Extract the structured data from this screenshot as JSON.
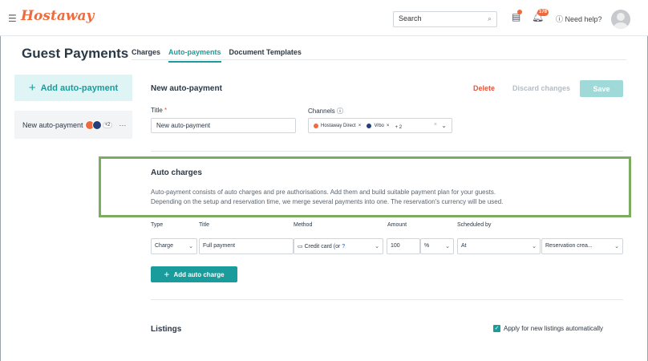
{
  "header": {
    "logo": "Hostaway",
    "search_placeholder": "Search",
    "badge_count": "178",
    "help": "Need help?"
  },
  "page": {
    "title": "Guest Payments",
    "tabs": [
      {
        "label": "Charges",
        "active": false
      },
      {
        "label": "Auto-payments",
        "active": true
      },
      {
        "label": "Document Templates",
        "active": false
      }
    ]
  },
  "sidebar": {
    "add_button": "Add auto-payment",
    "items": [
      {
        "label": "New auto-payment",
        "extra": "+2"
      }
    ]
  },
  "form": {
    "heading": "New auto-payment",
    "delete": "Delete",
    "discard": "Discard changes",
    "save": "Save",
    "title_label": "Title",
    "title_value": "New auto-payment",
    "channels_label": "Channels",
    "channels": [
      {
        "label": "Hostaway Direct",
        "color": "#ef6b3e"
      },
      {
        "label": "Vrbo",
        "color": "#24407a"
      }
    ],
    "channels_more": "+ 2"
  },
  "auto_charges": {
    "title": "Auto charges",
    "description_line1": "Auto-payment consists of auto charges and pre authorisations. Add them and build suitable payment plan for your guests.",
    "description_line2": "Depending on the setup and reservation time, we merge several payments into one. The reservation's currency will be used.",
    "columns": [
      "Type",
      "Title",
      "Method",
      "Amount",
      "Scheduled by"
    ],
    "row": {
      "type": "Charge",
      "title": "Full payment",
      "method": "Credit card (or",
      "amount": "100",
      "unit": "%",
      "scheduled": "At",
      "event": "Reservation crea..."
    },
    "add_button": "Add auto charge"
  },
  "listings": {
    "title": "Listings",
    "apply_label": "Apply for new listings automatically",
    "apply_checked": true
  },
  "colors": {
    "accent": "#1a9c9c",
    "brand": "#ef6b3e",
    "danger": "#e8543a",
    "highlight": "#7cad5e"
  }
}
